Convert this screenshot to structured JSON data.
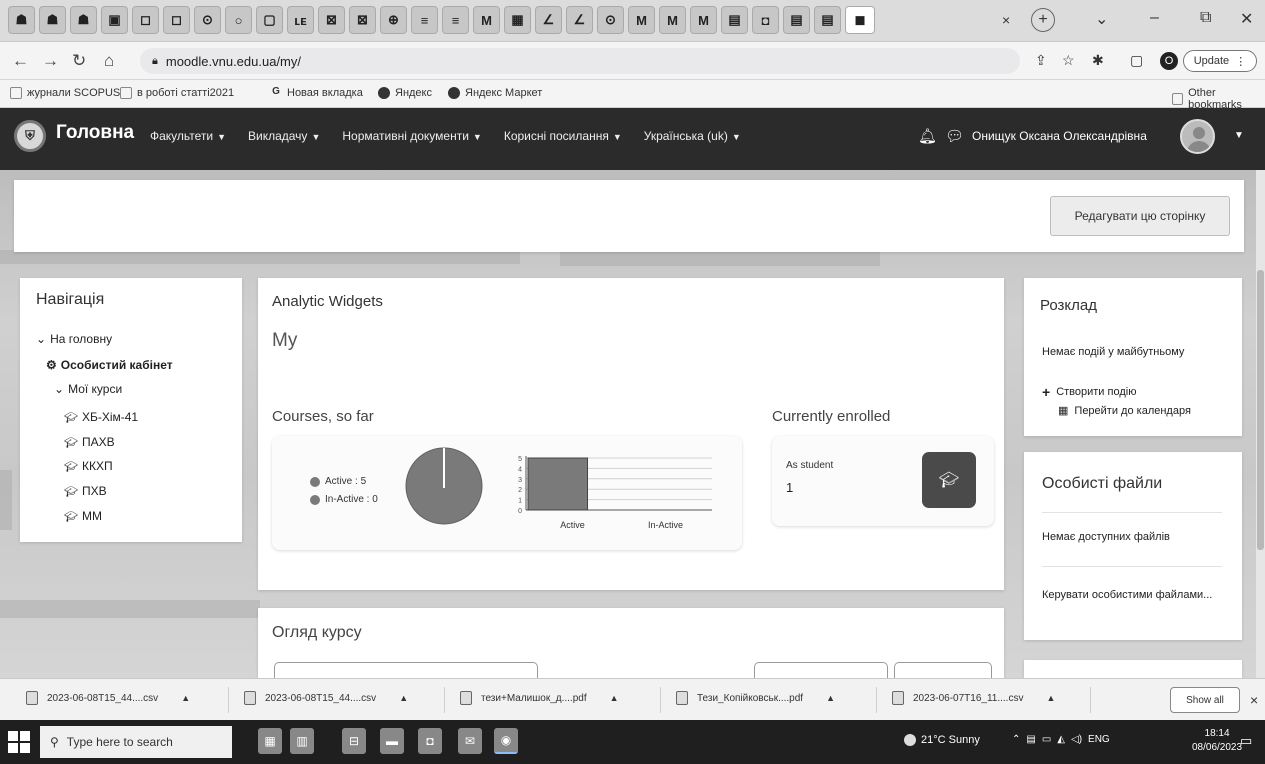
{
  "browser": {
    "tabs": [
      "☗",
      "☗",
      "☗",
      "▣",
      "◻",
      "◻",
      "⊙",
      "○",
      "▢",
      "ʟᴇ",
      "⊠",
      "⊠",
      "⊕",
      "≡",
      "≡",
      "M",
      "▦",
      "∠",
      "∠",
      "⊙",
      "M",
      "M",
      "M",
      "▤",
      "◘",
      "▤",
      "▤",
      "◼"
    ],
    "close_tab": "×",
    "new_tab": "+",
    "url": "moodle.vnu.edu.ua/my/",
    "profile_initial": "O",
    "update_label": "Update",
    "bookmarks": [
      "журнали SCOPUS",
      "в роботі статті2021",
      "Новая вкладка",
      "Яндекс",
      "Яндекс Маркет"
    ],
    "other_bookmarks": "Other bookmarks"
  },
  "moodle_nav": {
    "brand": "Головна",
    "menu": [
      "Факультети",
      "Викладачу",
      "Нормативні документи",
      "Корисні посилання",
      "Українська (uk)"
    ],
    "user_name": "Онищук Оксана Олександрівна"
  },
  "header": {
    "edit_button": "Редагувати цю сторінку"
  },
  "navigation": {
    "title": "Навігація",
    "home": "На головну",
    "dashboard": "Особистий кабінет",
    "my_courses": "Мої курси",
    "courses": [
      "ХБ-Хім-41",
      "ПАХВ",
      "ККХП",
      "ПХВ",
      "ММ"
    ]
  },
  "analytic": {
    "title": "Analytic Widgets",
    "subtitle": "My",
    "courses_so_far": "Courses, so far",
    "legend": [
      "Active : 5",
      "In-Active : 0"
    ],
    "currently_enrolled": "Currently enrolled",
    "as_student_label": "As student",
    "as_student_value": "1"
  },
  "chart_data": [
    {
      "type": "pie",
      "categories": [
        "Active",
        "In-Active"
      ],
      "values": [
        5,
        0
      ]
    },
    {
      "type": "bar",
      "categories": [
        "Active",
        "In-Active"
      ],
      "values": [
        5,
        0
      ],
      "ylim": [
        0,
        5
      ],
      "yticks": [
        "0",
        "1",
        "2",
        "3",
        "4",
        "5"
      ]
    }
  ],
  "course_overview": {
    "title": "Огляд курсу"
  },
  "calendar": {
    "title": "Розклад",
    "no_events": "Немає подій у майбутньому",
    "create_event": "Створити подію",
    "go_to_calendar": "Перейти до календаря"
  },
  "private_files": {
    "title": "Особисті файли",
    "no_files": "Немає доступних файлів",
    "manage": "Керувати особистими файлами..."
  },
  "downloads": {
    "items": [
      "2023-06-08T15_44....csv",
      "2023-06-08T15_44....csv",
      "тези+Малишок_д....pdf",
      "Тези_Копійковськ....pdf",
      "2023-06-07T16_11....csv"
    ],
    "show_all": "Show all",
    "close": "×"
  },
  "taskbar": {
    "search_placeholder": "Type here to search",
    "weather": "21°C Sunny",
    "lang": "ENG",
    "time": "18:14",
    "date": "08/06/2023"
  }
}
